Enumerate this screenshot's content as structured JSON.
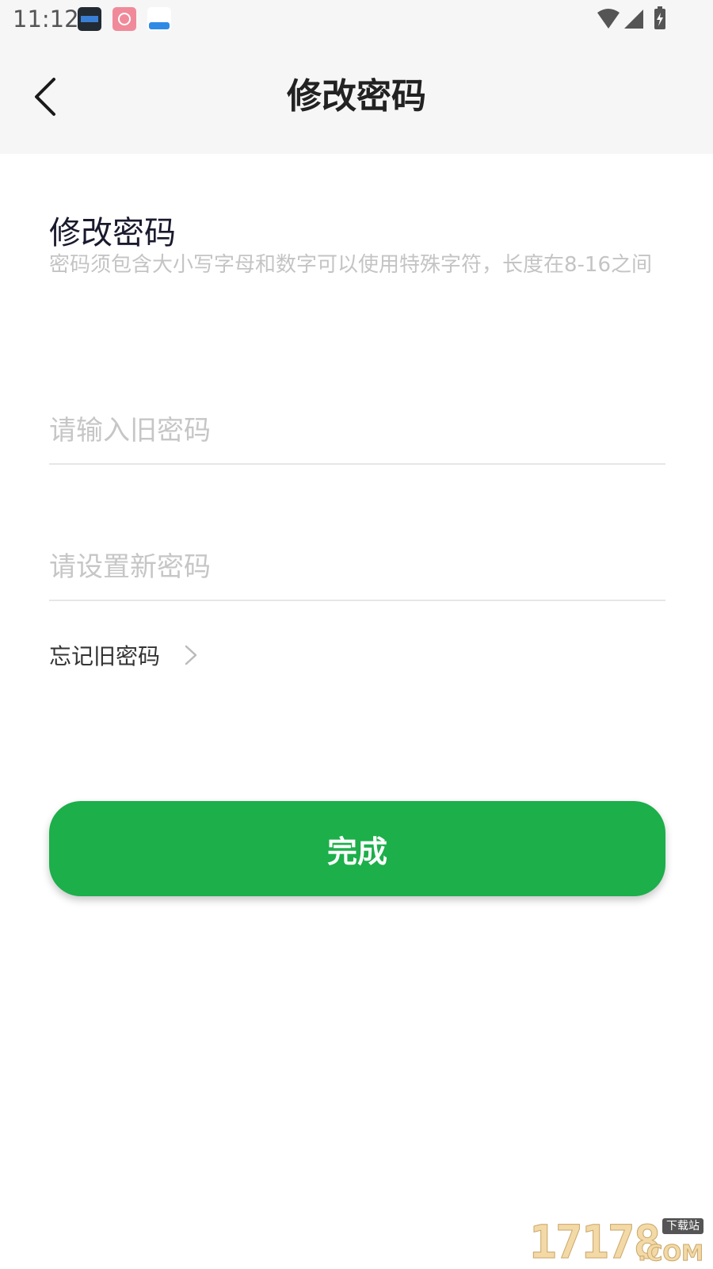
{
  "status_bar": {
    "time": "11:12",
    "notification_icons": [
      "clock-widget-app-icon",
      "pink-app-icon",
      "blue-app-icon"
    ],
    "indicator_icons": [
      "wifi-icon",
      "cellular-signal-icon",
      "battery-charging-icon"
    ]
  },
  "nav": {
    "back_icon": "chevron-left-icon",
    "title": "修改密码"
  },
  "form": {
    "section_title": "修改密码",
    "hint": "密码须包含大小写字母和数字可以使用特殊字符，长度在8-16之间",
    "old_password": {
      "placeholder": "请输入旧密码",
      "value": ""
    },
    "new_password": {
      "placeholder": "请设置新密码",
      "value": ""
    },
    "forgot_label": "忘记旧密码",
    "forgot_icon": "chevron-right-icon",
    "submit_label": "完成"
  },
  "colors": {
    "accent": "#1caf4a",
    "header_background": "#f6f6f6",
    "hint_text": "#c4c4c4"
  },
  "watermark": {
    "digits": "17178",
    "tag": "下载站",
    "suffix": ".COM"
  }
}
